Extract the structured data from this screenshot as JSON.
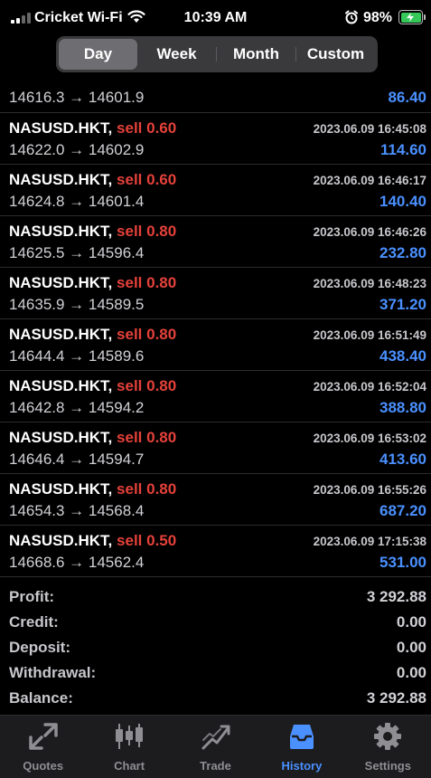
{
  "status": {
    "carrier": "Cricket Wi-Fi",
    "time": "10:39 AM",
    "battery": "98%"
  },
  "tabs_period": [
    {
      "label": "Day",
      "active": true
    },
    {
      "label": "Week",
      "active": false
    },
    {
      "label": "Month",
      "active": false
    },
    {
      "label": "Custom",
      "active": false
    }
  ],
  "partial_row": {
    "prices": "14616.3 → 14601.9",
    "profit": "86.40"
  },
  "deals": [
    {
      "symbol": "NASUSD.HKT,",
      "side": "sell 0.60",
      "time": "2023.06.09 16:45:08",
      "prices": "14622.0 → 14602.9",
      "profit": "114.60"
    },
    {
      "symbol": "NASUSD.HKT,",
      "side": "sell 0.60",
      "time": "2023.06.09 16:46:17",
      "prices": "14624.8 → 14601.4",
      "profit": "140.40"
    },
    {
      "symbol": "NASUSD.HKT,",
      "side": "sell 0.80",
      "time": "2023.06.09 16:46:26",
      "prices": "14625.5 → 14596.4",
      "profit": "232.80"
    },
    {
      "symbol": "NASUSD.HKT,",
      "side": "sell 0.80",
      "time": "2023.06.09 16:48:23",
      "prices": "14635.9 → 14589.5",
      "profit": "371.20"
    },
    {
      "symbol": "NASUSD.HKT,",
      "side": "sell 0.80",
      "time": "2023.06.09 16:51:49",
      "prices": "14644.4 → 14589.6",
      "profit": "438.40"
    },
    {
      "symbol": "NASUSD.HKT,",
      "side": "sell 0.80",
      "time": "2023.06.09 16:52:04",
      "prices": "14642.8 → 14594.2",
      "profit": "388.80"
    },
    {
      "symbol": "NASUSD.HKT,",
      "side": "sell 0.80",
      "time": "2023.06.09 16:53:02",
      "prices": "14646.4 → 14594.7",
      "profit": "413.60"
    },
    {
      "symbol": "NASUSD.HKT,",
      "side": "sell 0.80",
      "time": "2023.06.09 16:55:26",
      "prices": "14654.3 → 14568.4",
      "profit": "687.20"
    },
    {
      "symbol": "NASUSD.HKT,",
      "side": "sell 0.50",
      "time": "2023.06.09 17:15:38",
      "prices": "14668.6 → 14562.4",
      "profit": "531.00"
    }
  ],
  "summary": [
    {
      "label": "Profit:",
      "value": "3 292.88"
    },
    {
      "label": "Credit:",
      "value": "0.00"
    },
    {
      "label": "Deposit:",
      "value": "0.00"
    },
    {
      "label": "Withdrawal:",
      "value": "0.00"
    },
    {
      "label": "Balance:",
      "value": "3 292.88"
    }
  ],
  "tabbar": [
    {
      "label": "Quotes",
      "icon": "quotes-icon",
      "active": false
    },
    {
      "label": "Chart",
      "icon": "chart-icon",
      "active": false
    },
    {
      "label": "Trade",
      "icon": "trade-icon",
      "active": false
    },
    {
      "label": "History",
      "icon": "history-icon",
      "active": true
    },
    {
      "label": "Settings",
      "icon": "settings-icon",
      "active": false
    }
  ],
  "colors": {
    "sell": "#e5413a",
    "profit": "#4a90ff",
    "active_tab": "#4a90ff"
  }
}
